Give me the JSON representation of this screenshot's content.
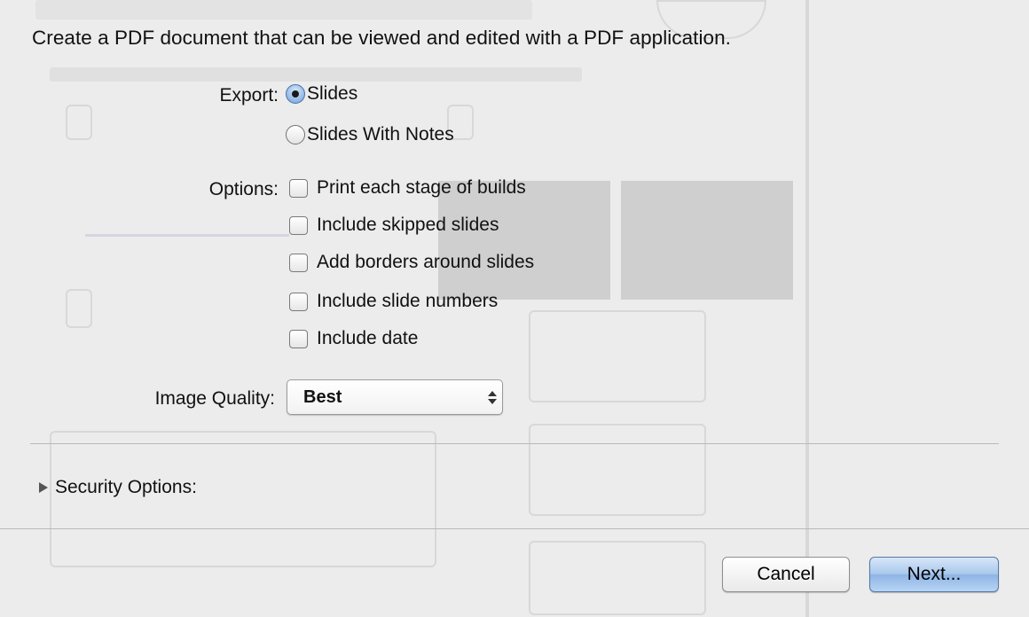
{
  "dialog": {
    "intro": "Create a PDF document that can be viewed and edited with a PDF application.",
    "export": {
      "label": "Export:",
      "options": [
        {
          "label": "Slides",
          "selected": true
        },
        {
          "label": "Slides With Notes",
          "selected": false
        }
      ]
    },
    "options": {
      "label": "Options:",
      "items": [
        {
          "label": "Print each stage of builds",
          "checked": false
        },
        {
          "label": "Include skipped slides",
          "checked": false
        },
        {
          "label": "Add borders around slides",
          "checked": false
        },
        {
          "label": "Include slide numbers",
          "checked": false
        },
        {
          "label": "Include date",
          "checked": false
        }
      ]
    },
    "image_quality": {
      "label": "Image Quality:",
      "value": "Best"
    },
    "security": {
      "label": "Security Options:",
      "expanded": false
    },
    "buttons": {
      "cancel": "Cancel",
      "next": "Next..."
    }
  },
  "icons": {
    "disclosure": "disclosure-triangle-icon",
    "popup": "up-down-arrows-icon"
  },
  "colors": {
    "sheet_background": "#ececec",
    "default_button": "#a9c8ec",
    "radio_selected": "#8fb4e3"
  }
}
